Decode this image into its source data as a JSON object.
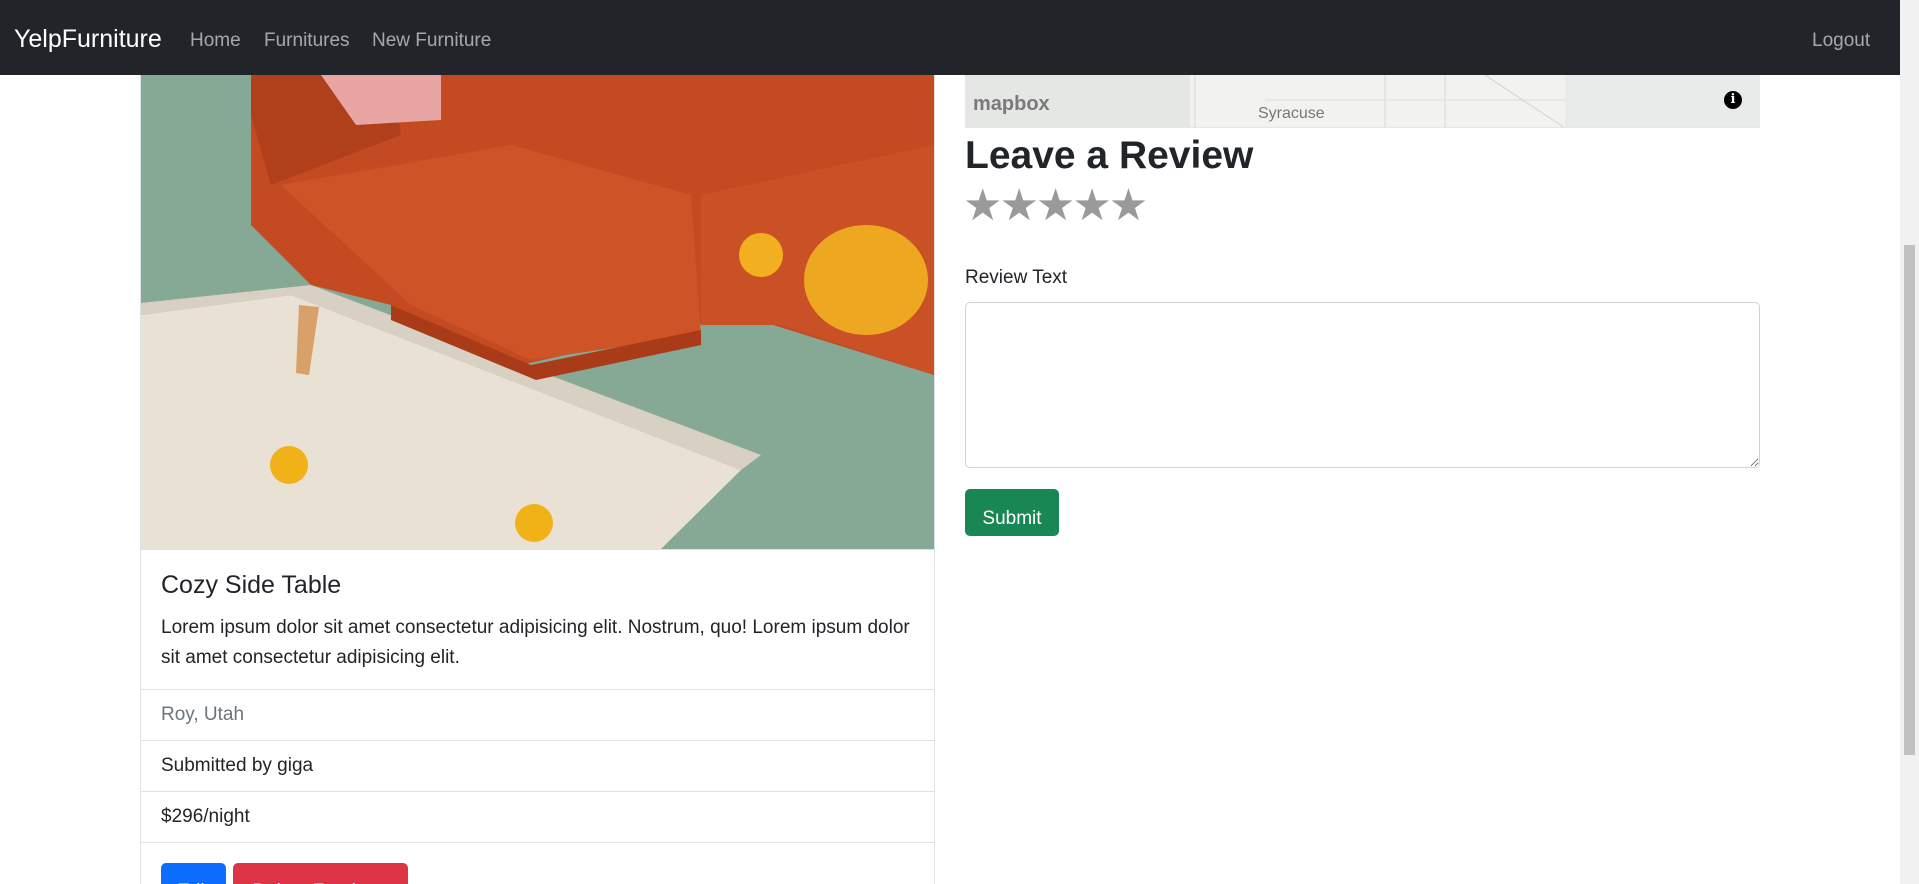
{
  "navbar": {
    "brand": "YelpFurniture",
    "links": [
      "Home",
      "Furnitures",
      "New Furniture"
    ],
    "logout": "Logout"
  },
  "furniture": {
    "title": "Cozy Side Table",
    "description": "Lorem ipsum dolor sit amet consectetur adipisicing elit. Nostrum, quo! Lorem ipsum dolor sit amet consectetur adipisicing elit.",
    "location": "Roy, Utah",
    "submitted_by": "Submitted by giga",
    "price": "$296/night",
    "edit_label": "Edit",
    "delete_label": "Delete Furniture"
  },
  "map": {
    "logo": "mapbox",
    "place_label": "Syracuse",
    "info_icon": "info-icon"
  },
  "review": {
    "title": "Leave a Review",
    "stars": "★★★★★",
    "text_label": "Review Text",
    "text_value": "",
    "submit_label": "Submit"
  },
  "colors": {
    "navbar": "#212529",
    "primary": "#0d6efd",
    "danger": "#dc3545",
    "success": "#198754",
    "sofa": "#c44a22"
  }
}
